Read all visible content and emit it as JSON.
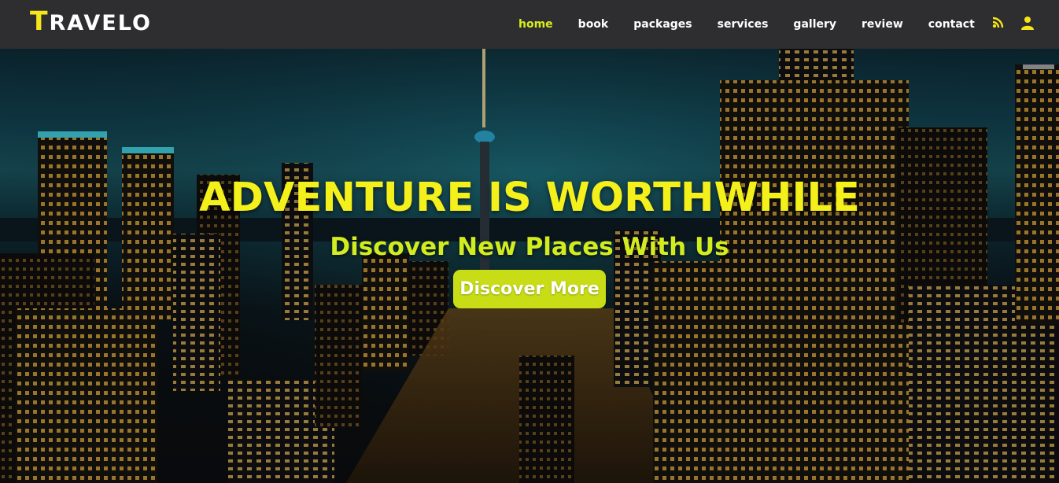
{
  "brand": {
    "first_letter": "T",
    "rest": "RAVELO",
    "accent": "#f5e61b"
  },
  "nav": {
    "items": [
      {
        "label": "home",
        "active": true
      },
      {
        "label": "book",
        "active": false
      },
      {
        "label": "packages",
        "active": false
      },
      {
        "label": "services",
        "active": false
      },
      {
        "label": "gallery",
        "active": false
      },
      {
        "label": "review",
        "active": false
      },
      {
        "label": "contact",
        "active": false
      }
    ],
    "active_color": "#d8ef1c"
  },
  "header_icons": [
    "wifi-icon",
    "user-icon"
  ],
  "hero": {
    "title": "ADVENTURE IS WORTHWHILE",
    "subtitle": "Discover New Places With Us",
    "button_label": "Discover More",
    "title_color": "#f3f01c",
    "button_color": "#c9dd16",
    "background": "night-city-skyline"
  }
}
